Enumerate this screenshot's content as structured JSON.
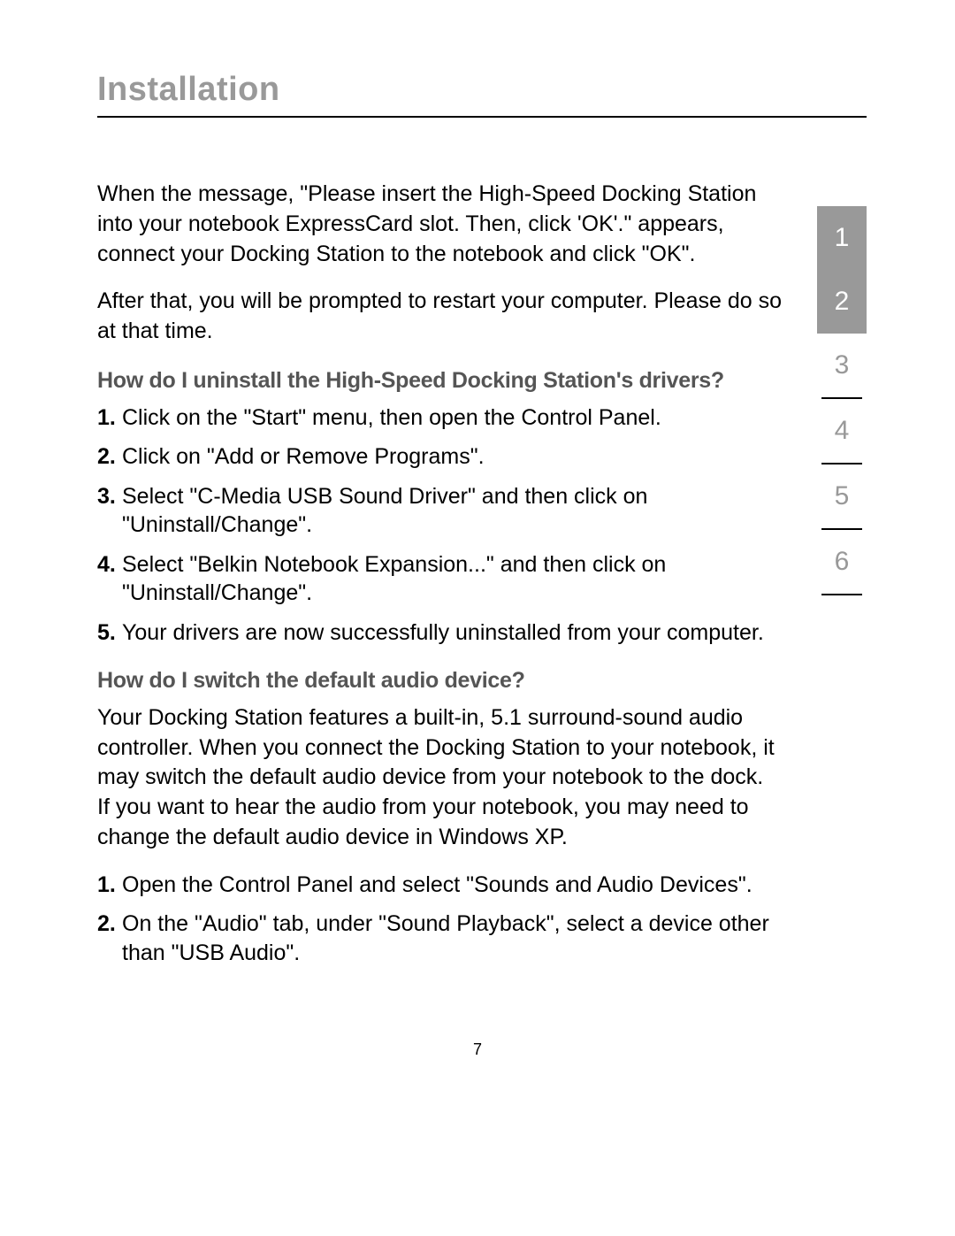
{
  "title": "Installation",
  "intro": {
    "p1": "When the message, \"Please insert the High-Speed Docking Station into your notebook ExpressCard slot. Then, click 'OK'.\" appears, connect your Docking Station to the notebook and click \"OK\".",
    "p2": "After that, you will be prompted to restart your computer. Please do so at that time."
  },
  "section1": {
    "heading": "How do I uninstall the High-Speed Docking Station's drivers?",
    "items": [
      "Click on the \"Start\" menu, then open the Control Panel.",
      "Click on \"Add or Remove Programs\".",
      "Select \"C-Media USB Sound Driver\" and then click on \"Uninstall/Change\".",
      "Select \"Belkin Notebook Expansion...\" and then click on \"Uninstall/Change\".",
      "Your drivers are now successfully uninstalled from your computer."
    ]
  },
  "section2": {
    "heading": "How do I switch the default audio device?",
    "intro": "Your Docking Station features a built-in, 5.1 surround-sound audio controller. When you connect the Docking Station to your notebook, it may switch the default audio device from your notebook to the dock. If you want to hear the audio from your notebook, you may need to change the default audio device in Windows XP.",
    "items": [
      "Open the Control Panel and select \"Sounds and Audio Devices\".",
      "On the \"Audio\" tab, under \"Sound Playback\", select a device other than \"USB Audio\"."
    ]
  },
  "nav": {
    "items": [
      "1",
      "2",
      "3",
      "4",
      "5",
      "6"
    ],
    "current": 1
  },
  "pageNumber": "7"
}
